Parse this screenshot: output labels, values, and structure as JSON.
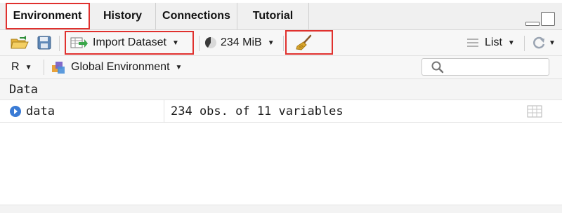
{
  "tabs": [
    {
      "label": "Environment"
    },
    {
      "label": "History"
    },
    {
      "label": "Connections"
    },
    {
      "label": "Tutorial"
    }
  ],
  "toolbar": {
    "import_label": "Import Dataset",
    "memory_label": "234 MiB",
    "view_label": "List"
  },
  "scope": {
    "language": "R",
    "env_label": "Global Environment"
  },
  "search": {
    "placeholder": ""
  },
  "section": {
    "title": "Data"
  },
  "rows": [
    {
      "name": "data",
      "value": "234 obs. of 11 variables"
    }
  ],
  "colors": {
    "highlight": "#e0312e",
    "accent_blue": "#3a7bd5",
    "broom": "#c9a227"
  },
  "icons": {
    "open": "folder-open-icon",
    "save": "save-icon",
    "import": "import-dataset-icon",
    "memory": "memory-pie-icon",
    "clear": "broom-icon",
    "list": "list-icon",
    "refresh": "refresh-icon",
    "search": "search-icon",
    "row_expand": "expand-row-icon",
    "grid": "view-grid-icon"
  }
}
